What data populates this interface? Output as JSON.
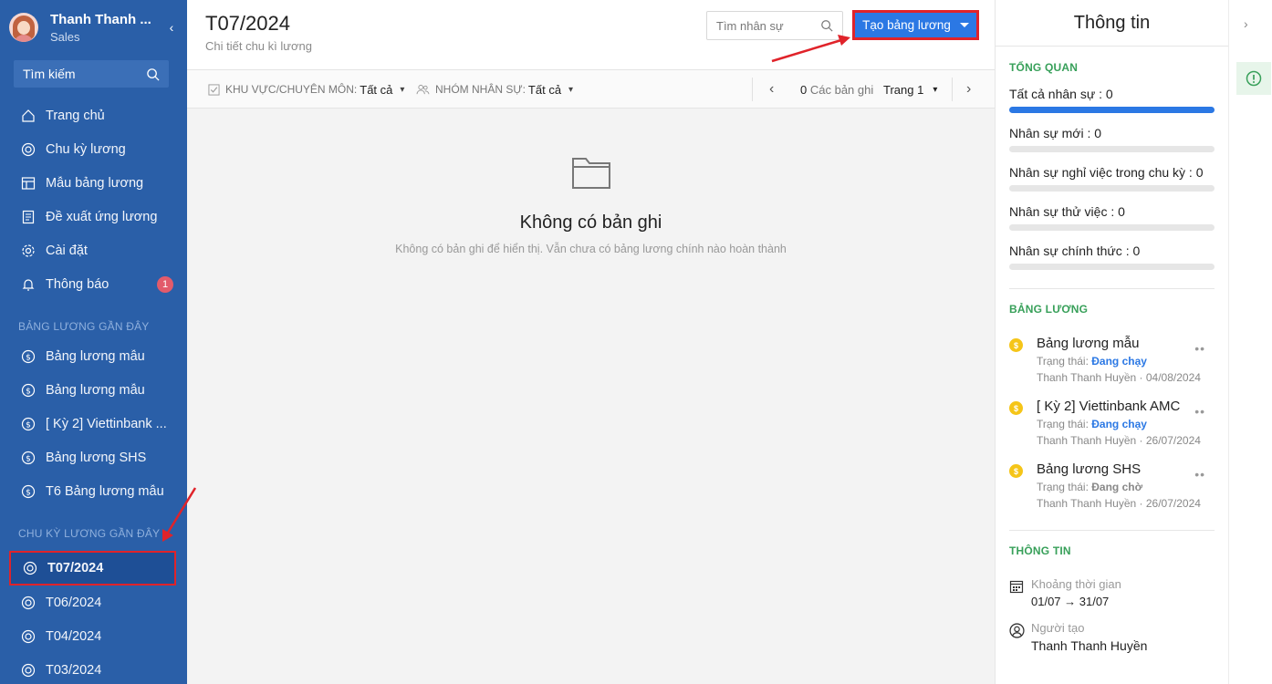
{
  "sidebar": {
    "user_name": "Thanh Thanh ...",
    "user_role": "Sales",
    "search_placeholder": "Tìm kiếm",
    "menu": [
      {
        "label": "Trang chủ",
        "icon": "home-icon"
      },
      {
        "label": "Chu kỳ lương",
        "icon": "cycle-icon"
      },
      {
        "label": "Mẫu bảng lương",
        "icon": "template-icon"
      },
      {
        "label": "Đề xuất ứng lương",
        "icon": "document-icon"
      },
      {
        "label": "Cài đặt",
        "icon": "gear-icon"
      },
      {
        "label": "Thông báo",
        "icon": "bell-icon",
        "badge": "1"
      }
    ],
    "recent_payrolls_label": "BẢNG LƯƠNG GẦN ĐÂY",
    "recent_payrolls": [
      "Bảng lương mẫu",
      "Bảng lương mẫu",
      "[ Kỳ 2] Viettinbank ...",
      "Bảng lương SHS",
      "T6 Bảng lương mẫu"
    ],
    "recent_cycles_label": "CHU KỲ LƯƠNG GẦN ĐÂY",
    "recent_cycles": [
      "T07/2024",
      "T06/2024",
      "T04/2024",
      "T03/2024"
    ]
  },
  "header": {
    "title": "T07/2024",
    "subtitle": "Chi tiết chu kì lương",
    "search_placeholder": "Tìm nhân sự",
    "create_button": "Tạo bảng lương"
  },
  "filters": {
    "area_label": "KHU VỰC/CHUYÊN MÔN:",
    "area_value": "Tất cả",
    "group_label": "NHÓM NHÂN SỰ:",
    "group_value": "Tất cả",
    "record_count": "0",
    "record_label": "Các bản ghi",
    "page_label": "Trang 1"
  },
  "empty_state": {
    "title": "Không có bản ghi",
    "description": "Không có bản ghi để hiển thị. Vẫn chưa có bảng lương chính nào hoàn thành"
  },
  "right_panel": {
    "title": "Thông tin",
    "overview_label": "TỔNG QUAN",
    "stats": [
      {
        "label": "Tất cả nhân sự : 0",
        "fill_percent": 100
      },
      {
        "label": "Nhân sự mới : 0",
        "fill_percent": 0
      },
      {
        "label": "Nhân sự nghỉ việc trong chu kỳ : 0",
        "fill_percent": 0
      },
      {
        "label": "Nhân sự thử việc : 0",
        "fill_percent": 0
      },
      {
        "label": "Nhân sự chính thức : 0",
        "fill_percent": 0
      }
    ],
    "payroll_label": "BẢNG LƯƠNG",
    "payrolls": [
      {
        "name": "Bảng lương mẫu",
        "status_prefix": "Trạng thái:",
        "status": "Đang chạy",
        "meta": "Thanh Thanh Huyền · 04/08/2024"
      },
      {
        "name": "[ Kỳ 2] Viettinbank AMC",
        "status_prefix": "Trạng thái:",
        "status": "Đang chạy",
        "meta": "Thanh Thanh Huyền · 26/07/2024"
      },
      {
        "name": "Bảng lương SHS",
        "status_prefix": "Trạng thái:",
        "status": "Đang chờ",
        "meta": "Thanh Thanh Huyền · 26/07/2024"
      }
    ],
    "info_label": "THÔNG TIN",
    "period_label": "Khoảng thời gian",
    "period_value": "01/07 → 31/07",
    "creator_label": "Người tạo",
    "creator_value": "Thanh Thanh Huyền"
  },
  "colors": {
    "sidebar_bg": "#2a5fa8",
    "primary": "#2b78e4",
    "accent_green": "#38a05a",
    "annotation_red": "#e0232a"
  }
}
